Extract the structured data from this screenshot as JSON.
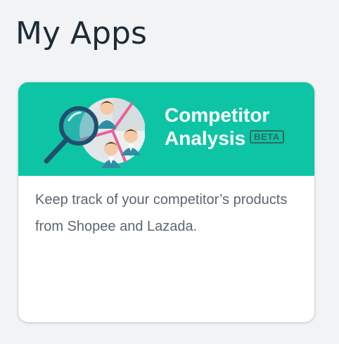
{
  "page": {
    "title": "My Apps"
  },
  "app_card": {
    "name_line1": "Competitor",
    "name_line2": "Analysis",
    "badge": "BETA",
    "description": "Keep track of your competitor’s products from Shopee and Lazada.",
    "colors": {
      "banner": "#0dc5a5",
      "badge": "#2f6a60",
      "text": "#5c6670"
    }
  },
  "icons": {
    "illustration": "competitor-analysis-illustration",
    "magnifier": "magnifying-glass-icon"
  }
}
